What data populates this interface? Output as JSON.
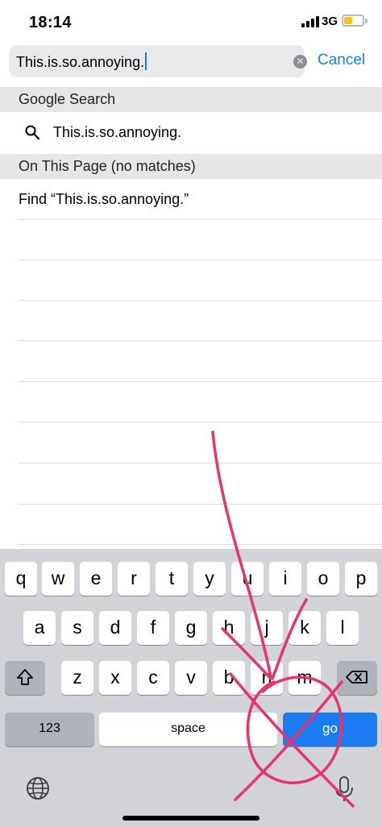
{
  "status_bar": {
    "time": "18:14",
    "network": "3G",
    "battery_color": "#f7c60a",
    "battery_level": 0.45
  },
  "search": {
    "query": "This.is.so.annoying.",
    "cancel_label": "Cancel",
    "accent_color": "#1a7cf0"
  },
  "sections": {
    "google": {
      "header": "Google Search",
      "suggestion": "This.is.so.annoying."
    },
    "page": {
      "header": "On This Page (no matches)",
      "find_label": "Find “This.is.so.annoying.”"
    }
  },
  "keyboard": {
    "row1": [
      "q",
      "w",
      "e",
      "r",
      "t",
      "y",
      "u",
      "i",
      "o",
      "p"
    ],
    "row2": [
      "a",
      "s",
      "d",
      "f",
      "g",
      "h",
      "j",
      "k",
      "l"
    ],
    "row3": [
      "z",
      "x",
      "c",
      "v",
      "b",
      "n",
      "m"
    ],
    "numbers_label": "123",
    "space_label": "space",
    "go_label": "go",
    "icons": [
      "shift-icon",
      "backspace-icon",
      "globe-icon",
      "microphone-icon"
    ]
  },
  "annotation": {
    "color": "#e8336b",
    "shapes": [
      "arrow",
      "circle",
      "cross"
    ]
  }
}
